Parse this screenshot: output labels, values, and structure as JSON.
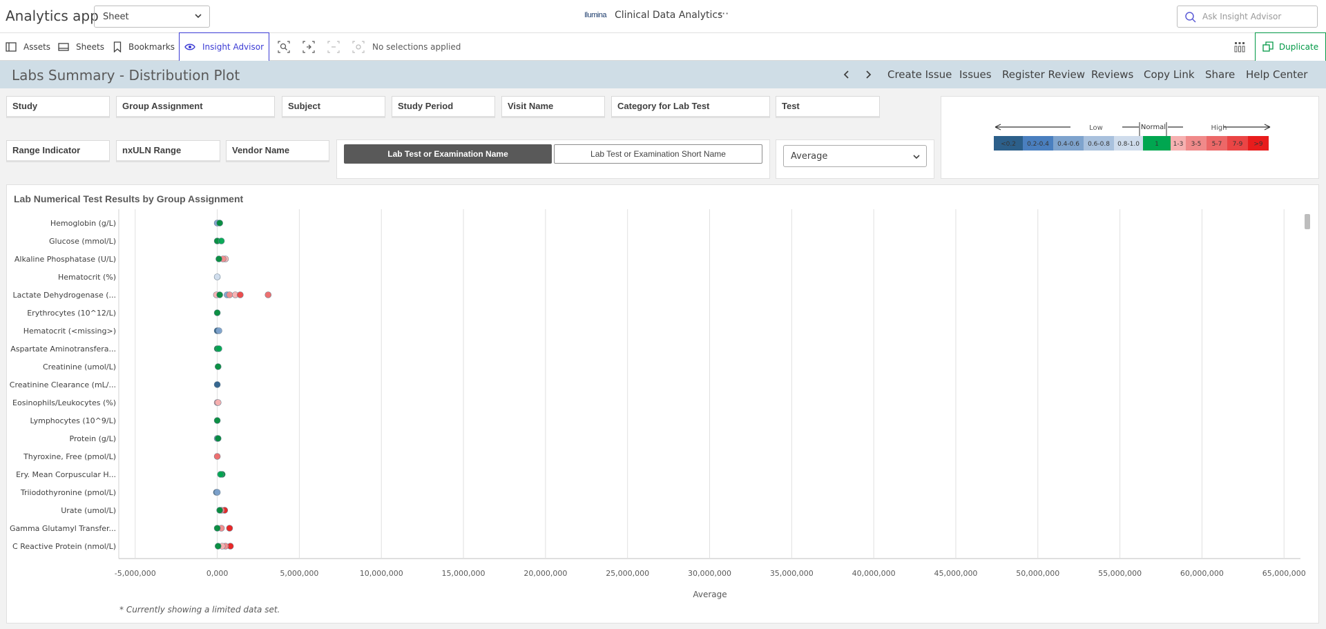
{
  "header": {
    "app_title": "Analytics app",
    "sheet_dropdown": "Sheet",
    "logo_text": "Ilumina",
    "center_title": "Clinical Data Analytics",
    "more_label": "···",
    "ask_placeholder": "Ask Insight Advisor"
  },
  "toolbar": {
    "assets": "Assets",
    "sheets": "Sheets",
    "bookmarks": "Bookmarks",
    "insight_advisor": "Insight Advisor",
    "no_selections": "No selections applied",
    "duplicate": "Duplicate"
  },
  "titlebar": {
    "sheet_title": "Labs Summary - Distribution Plot",
    "links": [
      "Create Issue",
      "Issues",
      "Register Review",
      "Reviews",
      "Copy Link",
      "Share",
      "Help Center"
    ]
  },
  "filters": {
    "row1": [
      "Study",
      "Group Assignment",
      "Subject",
      "Study Period",
      "Visit Name",
      "Category for Lab Test",
      "Test"
    ],
    "row2": [
      "Range Indicator",
      "nxULN Range",
      "Vendor Name"
    ]
  },
  "toggle_buttons": {
    "active": "Lab Test or Examination Name",
    "inactive": "Lab Test or Examination Short Name"
  },
  "aggregation_select": "Average",
  "legend": {
    "low_label": "Low",
    "normal_label": "Normal",
    "high_label": "High",
    "cells": [
      {
        "label": "<0.2",
        "color": "#2c5f8a"
      },
      {
        "label": "0.2-0.4",
        "color": "#4a7fbf"
      },
      {
        "label": "0.4-0.6",
        "color": "#7ea3cd"
      },
      {
        "label": "0.6-0.8",
        "color": "#a9c1dd"
      },
      {
        "label": "0.8-1.0",
        "color": "#cfdcec"
      },
      {
        "label": "1",
        "color": "#00a650"
      },
      {
        "label": "1-3",
        "color": "#f6b1b1"
      },
      {
        "label": "3-5",
        "color": "#f08a8a"
      },
      {
        "label": "5-7",
        "color": "#ec6868"
      },
      {
        "label": "7-9",
        "color": "#ea4545"
      },
      {
        "label": ">9",
        "color": "#e81c1c"
      }
    ]
  },
  "chart_data": {
    "type": "scatter",
    "title": "Lab Numerical Test Results by Group Assignment",
    "xlabel": "Average",
    "xlim": [
      -6000000,
      66000000
    ],
    "xticks": [
      -5000000,
      0,
      5000000,
      10000000,
      15000000,
      20000000,
      25000000,
      30000000,
      35000000,
      40000000,
      45000000,
      50000000,
      55000000,
      60000000,
      65000000
    ],
    "xtick_labels": [
      "-5,000,000",
      "0,000",
      "5,000,000",
      "10,000,000",
      "15,000,000",
      "20,000,000",
      "25,000,000",
      "30,000,000",
      "35,000,000",
      "40,000,000",
      "45,000,000",
      "50,000,000",
      "55,000,000",
      "60,000,000",
      "65,000,000"
    ],
    "grid": "vertical",
    "categories": [
      "Hemoglobin (g/L)",
      "Glucose (mmol/L)",
      "Alkaline Phosphatase (U/L)",
      "Hematocrit (%)",
      "Lactate Dehydrogenase (...",
      "Erythrocytes (10^12/L)",
      "Hematocrit (<missing>)",
      "Aspartate Aminotransfera...",
      "Creatinine (umol/L)",
      "Creatinine Clearance (mL/...",
      "Eosinophils/Leukocytes (%)",
      "Lymphocytes (10^9/L)",
      "Protein (g/L)",
      "Thyroxine, Free (pmol/L)",
      "Ery. Mean Corpuscular H...",
      "Triiodothyronine (pmol/L)",
      "Urate (umol/L)",
      "Gamma Glutamyl Transfer...",
      "C Reactive Protein (nmol/L)"
    ],
    "points": [
      {
        "row": 0,
        "x": 0,
        "color": "#7ea3cd"
      },
      {
        "row": 0,
        "x": 150000,
        "color": "#008a3a"
      },
      {
        "row": 1,
        "x": 0,
        "color": "#008a3a"
      },
      {
        "row": 1,
        "x": 250000,
        "color": "#00a650"
      },
      {
        "row": 2,
        "x": 500000,
        "color": "#f6b1b1"
      },
      {
        "row": 2,
        "x": 350000,
        "color": "#f08a8a"
      },
      {
        "row": 2,
        "x": 100000,
        "color": "#008a3a"
      },
      {
        "row": 3,
        "x": 0,
        "color": "#cfdcec"
      },
      {
        "row": 4,
        "x": -50000,
        "color": "#f6b1b1"
      },
      {
        "row": 4,
        "x": 600000,
        "color": "#7ea3cd"
      },
      {
        "row": 4,
        "x": 750000,
        "color": "#f08a8a"
      },
      {
        "row": 4,
        "x": 1100000,
        "color": "#f6b1b1"
      },
      {
        "row": 4,
        "x": 1400000,
        "color": "#ea4545"
      },
      {
        "row": 4,
        "x": 3100000,
        "color": "#ec6868"
      },
      {
        "row": 4,
        "x": 150000,
        "color": "#008a3a"
      },
      {
        "row": 5,
        "x": 0,
        "color": "#008a3a"
      },
      {
        "row": 6,
        "x": 0,
        "color": "#2c5f8a"
      },
      {
        "row": 6,
        "x": 100000,
        "color": "#7ea3cd"
      },
      {
        "row": 7,
        "x": 0,
        "color": "#008a3a"
      },
      {
        "row": 7,
        "x": 100000,
        "color": "#00a650"
      },
      {
        "row": 8,
        "x": 50000,
        "color": "#008a3a"
      },
      {
        "row": 9,
        "x": 0,
        "color": "#2c5f8a"
      },
      {
        "row": 10,
        "x": 0,
        "color": "#f08a8a"
      },
      {
        "row": 10,
        "x": 50000,
        "color": "#f6b1b1"
      },
      {
        "row": 11,
        "x": 0,
        "color": "#008a3a"
      },
      {
        "row": 12,
        "x": 0,
        "color": "#7ea3cd"
      },
      {
        "row": 12,
        "x": 50000,
        "color": "#008a3a"
      },
      {
        "row": 13,
        "x": 0,
        "color": "#ec6868"
      },
      {
        "row": 14,
        "x": 300000,
        "color": "#008a3a"
      },
      {
        "row": 14,
        "x": 200000,
        "color": "#00a650"
      },
      {
        "row": 15,
        "x": -50000,
        "color": "#2c5f8a"
      },
      {
        "row": 15,
        "x": 0,
        "color": "#7ea3cd"
      },
      {
        "row": 16,
        "x": 450000,
        "color": "#e81c1c"
      },
      {
        "row": 16,
        "x": 250000,
        "color": "#f08a8a"
      },
      {
        "row": 16,
        "x": 150000,
        "color": "#008a3a"
      },
      {
        "row": 17,
        "x": 750000,
        "color": "#e81c1c"
      },
      {
        "row": 17,
        "x": 250000,
        "color": "#f08a8a"
      },
      {
        "row": 17,
        "x": 0,
        "color": "#008a3a"
      },
      {
        "row": 18,
        "x": 800000,
        "color": "#e81c1c"
      },
      {
        "row": 18,
        "x": 500000,
        "color": "#f08a8a"
      },
      {
        "row": 18,
        "x": 300000,
        "color": "#f6b1b1"
      },
      {
        "row": 18,
        "x": 50000,
        "color": "#008a3a"
      }
    ]
  },
  "footnote": "* Currently showing a limited data set."
}
